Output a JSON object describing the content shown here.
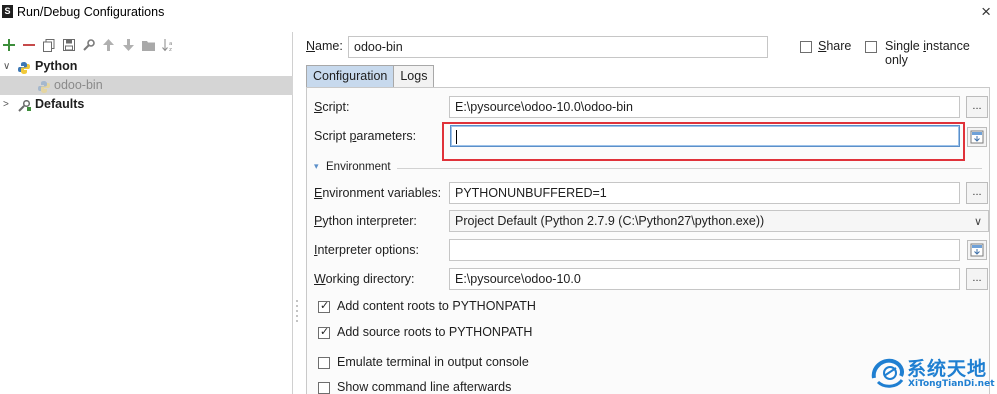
{
  "window": {
    "title": "Run/Debug Configurations",
    "close_glyph": "×",
    "app_icon_glyph": "S"
  },
  "toolbar": {
    "icons": [
      "add-icon",
      "remove-icon",
      "copy-icon",
      "save-icon",
      "wrench-icon",
      "up-arrow-icon",
      "down-arrow-icon",
      "folder-icon",
      "sort-icon"
    ]
  },
  "tree": {
    "python": {
      "label": "Python",
      "arrow": "∨"
    },
    "odoo": {
      "label": "odoo-bin"
    },
    "defaults": {
      "label": "Defaults",
      "arrow": ">"
    }
  },
  "name_row": {
    "name_label_prefix": "N",
    "name_label_rest": "ame:",
    "name_value": "odoo-bin",
    "share_prefix": "S",
    "share_rest": "hare",
    "share_checked": false,
    "single_before": "Single ",
    "single_u": "i",
    "single_after": "nstance only",
    "single_checked": false
  },
  "tabs": [
    {
      "label": "Configuration",
      "active": true
    },
    {
      "label": "Logs",
      "active": false
    }
  ],
  "config": {
    "script_label_u": "S",
    "script_label_rest": "cript:",
    "script_value": "E:\\pysource\\odoo-10.0\\odoo-bin",
    "params_label_before": "Script ",
    "params_label_u": "p",
    "params_label_after": "arameters:",
    "params_value": "",
    "env_section": "Environment",
    "env_vars_label_u": "E",
    "env_vars_label_rest": "nvironment variables:",
    "env_vars_value": "PYTHONUNBUFFERED=1",
    "interp_label_u": "P",
    "interp_label_rest": "ython interpreter:",
    "interp_value": "Project Default (Python 2.7.9 (C:\\Python27\\python.exe))",
    "interp_opts_label_u": "I",
    "interp_opts_label_rest": "nterpreter options:",
    "interp_opts_value": "",
    "workdir_label_u": "W",
    "workdir_label_rest": "orking directory:",
    "workdir_value": "E:\\pysource\\odoo-10.0",
    "ellipsis": "...",
    "dropdown_glyph": "∨",
    "section_glyph": "▾"
  },
  "options": [
    {
      "label": "Add content roots to PYTHONPATH",
      "checked": true
    },
    {
      "label": "Add source roots to PYTHONPATH",
      "checked": true
    },
    {
      "label": "Emulate terminal in output console",
      "checked": false
    },
    {
      "label": "Show command line afterwards",
      "checked": false
    }
  ],
  "watermark": {
    "title": "系统天地",
    "subtitle": "XiTongTianDi.net"
  },
  "colors": {
    "highlight": "#e0323a",
    "tab_active": "#c7d9ed",
    "selection": "#d5d5d5",
    "watermark": "#1f7fd1"
  }
}
